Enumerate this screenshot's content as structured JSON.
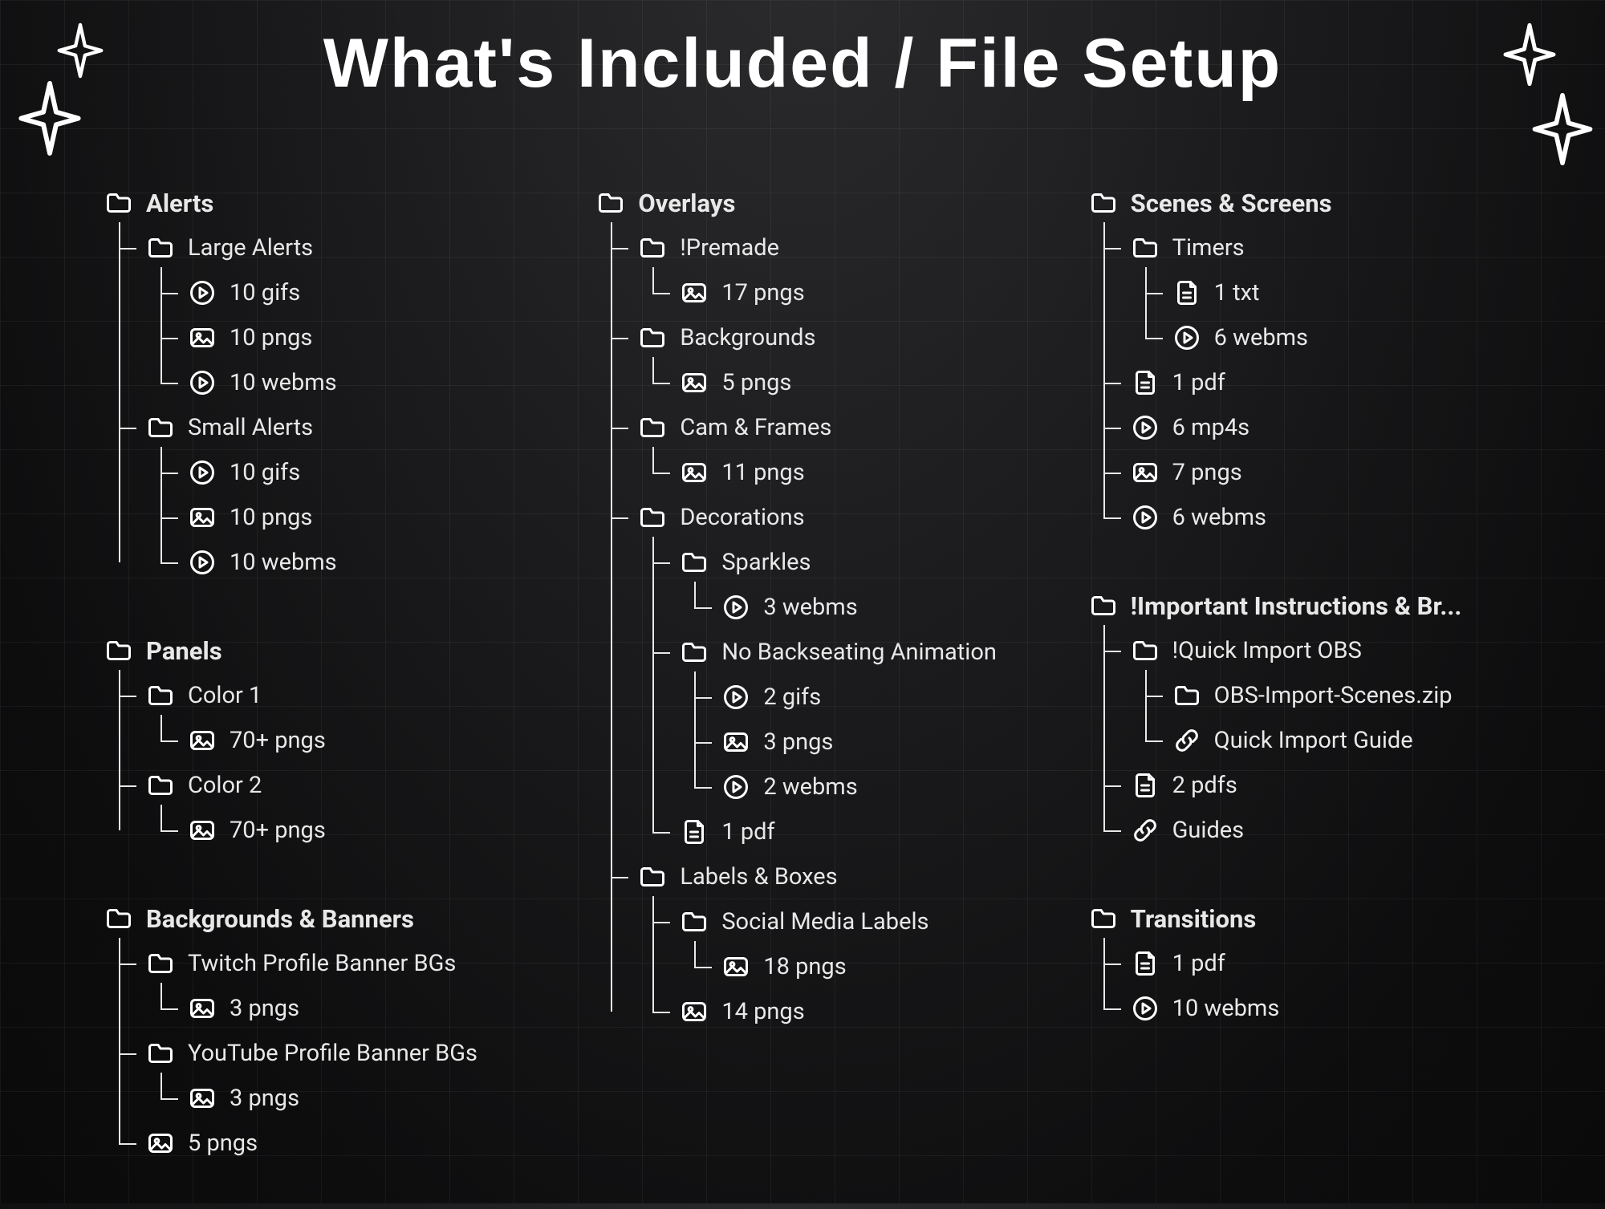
{
  "title": "What's Included / File Setup",
  "columns": [
    [
      {
        "label": "Alerts",
        "children": [
          {
            "label": "Large Alerts",
            "icon": "folder",
            "children": [
              {
                "label": "10 gifs",
                "icon": "play"
              },
              {
                "label": "10 pngs",
                "icon": "image"
              },
              {
                "label": "10 webms",
                "icon": "play"
              }
            ]
          },
          {
            "label": "Small Alerts",
            "icon": "folder",
            "children": [
              {
                "label": "10 gifs",
                "icon": "play"
              },
              {
                "label": "10 pngs",
                "icon": "image"
              },
              {
                "label": "10 webms",
                "icon": "play"
              }
            ]
          }
        ]
      },
      {
        "label": "Panels",
        "children": [
          {
            "label": "Color 1",
            "icon": "folder",
            "children": [
              {
                "label": "70+ pngs",
                "icon": "image"
              }
            ]
          },
          {
            "label": "Color 2",
            "icon": "folder",
            "children": [
              {
                "label": "70+ pngs",
                "icon": "image"
              }
            ]
          }
        ]
      },
      {
        "label": "Backgrounds & Banners",
        "children": [
          {
            "label": "Twitch Profile Banner BGs",
            "icon": "folder",
            "children": [
              {
                "label": "3 pngs",
                "icon": "image"
              }
            ]
          },
          {
            "label": "YouTube Profile Banner BGs",
            "icon": "folder",
            "children": [
              {
                "label": "3 pngs",
                "icon": "image"
              }
            ]
          },
          {
            "label": "5 pngs",
            "icon": "image"
          }
        ]
      }
    ],
    [
      {
        "label": "Overlays",
        "children": [
          {
            "label": "!Premade",
            "icon": "folder",
            "children": [
              {
                "label": "17 pngs",
                "icon": "image"
              }
            ]
          },
          {
            "label": "Backgrounds",
            "icon": "folder",
            "children": [
              {
                "label": "5 pngs",
                "icon": "image"
              }
            ]
          },
          {
            "label": "Cam & Frames",
            "icon": "folder",
            "children": [
              {
                "label": "11 pngs",
                "icon": "image"
              }
            ]
          },
          {
            "label": "Decorations",
            "icon": "folder",
            "children": [
              {
                "label": "Sparkles",
                "icon": "folder",
                "children": [
                  {
                    "label": "3 webms",
                    "icon": "play"
                  }
                ]
              },
              {
                "label": "No Backseating Animation",
                "icon": "folder",
                "children": [
                  {
                    "label": "2 gifs",
                    "icon": "play"
                  },
                  {
                    "label": "3 pngs",
                    "icon": "image"
                  },
                  {
                    "label": "2 webms",
                    "icon": "play"
                  }
                ]
              },
              {
                "label": "1 pdf",
                "icon": "doc"
              }
            ]
          },
          {
            "label": "Labels & Boxes",
            "icon": "folder",
            "children": [
              {
                "label": "Social Media Labels",
                "icon": "folder",
                "children": [
                  {
                    "label": "18 pngs",
                    "icon": "image"
                  }
                ]
              },
              {
                "label": "14 pngs",
                "icon": "image"
              }
            ]
          }
        ]
      }
    ],
    [
      {
        "label": "Scenes & Screens",
        "children": [
          {
            "label": "Timers",
            "icon": "folder",
            "children": [
              {
                "label": "1 txt",
                "icon": "doc"
              },
              {
                "label": "6 webms",
                "icon": "play"
              }
            ]
          },
          {
            "label": "1 pdf",
            "icon": "doc"
          },
          {
            "label": "6 mp4s",
            "icon": "play"
          },
          {
            "label": "7 pngs",
            "icon": "image"
          },
          {
            "label": "6 webms",
            "icon": "play"
          }
        ]
      },
      {
        "label": "!Important Instructions & Br...",
        "children": [
          {
            "label": "!Quick Import OBS",
            "icon": "folder",
            "children": [
              {
                "label": "OBS-Import-Scenes.zip",
                "icon": "folder"
              },
              {
                "label": "Quick Import Guide",
                "icon": "link"
              }
            ]
          },
          {
            "label": "2 pdfs",
            "icon": "doc"
          },
          {
            "label": "Guides",
            "icon": "link"
          }
        ]
      },
      {
        "label": "Transitions",
        "children": [
          {
            "label": "1 pdf",
            "icon": "doc"
          },
          {
            "label": "10 webms",
            "icon": "play"
          }
        ]
      }
    ]
  ]
}
